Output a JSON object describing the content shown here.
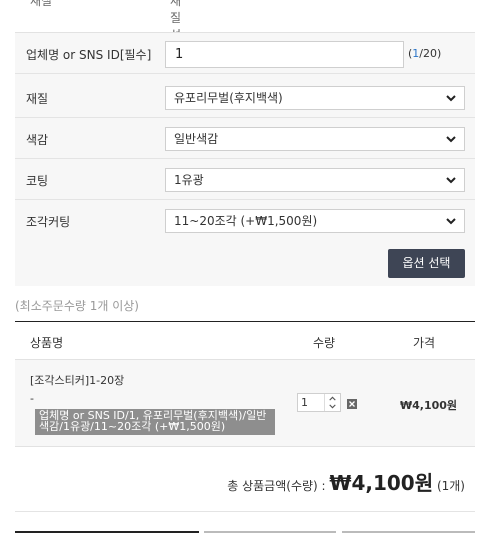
{
  "top_cut": {
    "label": "재질",
    "value": "재질선택(필수)"
  },
  "options": {
    "name_row": {
      "label": "업체명 or SNS ID[필수]",
      "value": "1",
      "count_current": "1",
      "count_max": "/20"
    },
    "material": {
      "label": "재질",
      "selected": "유포리무벌(후지백색)"
    },
    "color": {
      "label": "색감",
      "selected": "일반색감"
    },
    "coating": {
      "label": "코팅",
      "selected": "1유광"
    },
    "cutting": {
      "label": "조각커팅",
      "selected": "11~20조각 (+₩1,500원)"
    },
    "select_button": "옵션 선택"
  },
  "min_order_note": "(최소주문수량 1개 이상)",
  "table": {
    "headers": {
      "name": "상품명",
      "qty": "수량",
      "price": "가격"
    },
    "row": {
      "name": "[조각스티커]1-20장",
      "dash": "-",
      "option_line1": "업체명 or SNS ID/1, 유포리무벌(후지백색)/일반",
      "option_line2": "색감/1유광/11~20조각 (+₩1,500원)",
      "qty": "1",
      "price": "₩4,100원"
    }
  },
  "total": {
    "label": "총 상품금액(수량) : ",
    "amount": "₩4,100원",
    "count": "(1개)"
  },
  "colors": {
    "button_bg": "#3e4555",
    "counter_accent": "#2a74c7",
    "option_tag_bg": "#8e8e8e"
  },
  "icons": [
    "chevron-down-icon",
    "spinner-arrows-icon",
    "close-icon"
  ]
}
